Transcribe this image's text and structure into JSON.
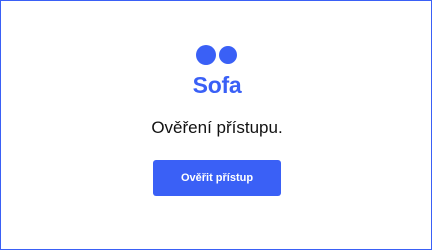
{
  "brand": {
    "name": "Sofa",
    "logo_icon": "two-circles-logo",
    "color": "#3a60f6"
  },
  "message": "Ověření přístupu.",
  "verify_button": {
    "label": "Ověřit přístup",
    "color": "#3a60f6"
  },
  "colors": {
    "border": "#3a60f6",
    "background": "#ffffff",
    "text": "#111111"
  }
}
